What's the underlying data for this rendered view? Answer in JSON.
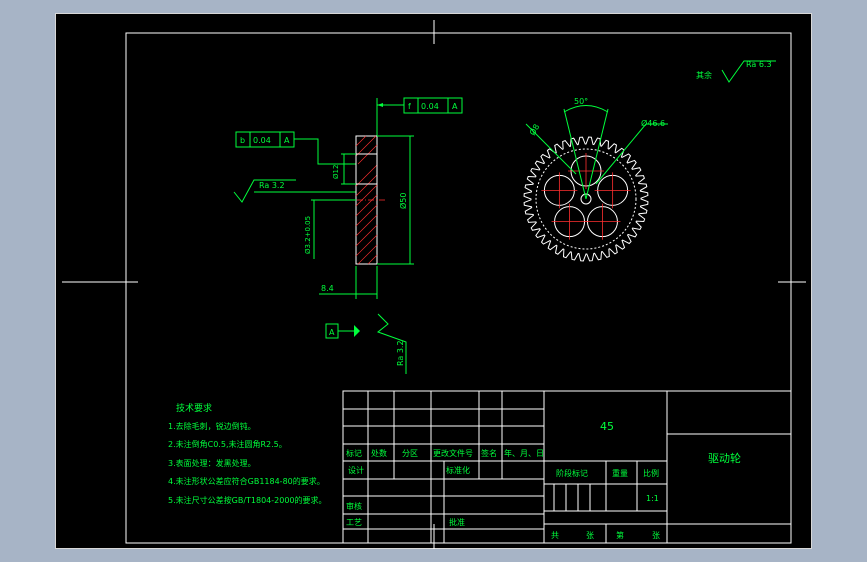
{
  "surface_finish_default": {
    "prefix": "其余",
    "label": "Ra 6.3"
  },
  "side_view": {
    "datum_b_frame": {
      "symbol": "b",
      "tolerance": "0.04",
      "datum": "A"
    },
    "flatness_frame": {
      "symbol": "f",
      "tolerance": "0.04",
      "datum": "A"
    },
    "roughness_left": "Ra 3.2",
    "roughness_bottom": "Ra 3.2",
    "dim_bore": "Ø12",
    "dim_outer": "Ø50",
    "dim_bore_tol": "Ø3.2+0.05",
    "dim_thickness": "8.4",
    "datum_label": "A"
  },
  "front_view": {
    "angle": "50°",
    "dim_holes": "Ø8",
    "dim_pitch": "Ø46.6",
    "teeth": 44
  },
  "tech_requirements": {
    "title": "技术要求",
    "items": [
      "1.去除毛刺，锐边倒钝。",
      "2.未注倒角C0.5,未注圆角R2.5。",
      "3.表面处理：发黑处理。",
      "4.未注形状公差应符合GB1184-80的要求。",
      "5.未注尺寸公差按GB/T1804-2000的要求。"
    ]
  },
  "title_block": {
    "material": "45",
    "part_name": "驱动轮",
    "headers": [
      "标记",
      "处数",
      "分区",
      "更改文件号",
      "签名",
      "年、月、日"
    ],
    "design": "设计",
    "standardization": "标准化",
    "stage_mark": "阶段标记",
    "weight": "重量",
    "scale_label": "比例",
    "scale": "1:1",
    "review": "审核",
    "process": "工艺",
    "approve": "批准",
    "total": "共",
    "sheets_label": "张",
    "sheet_no": "第",
    "sheet_label": "张"
  }
}
